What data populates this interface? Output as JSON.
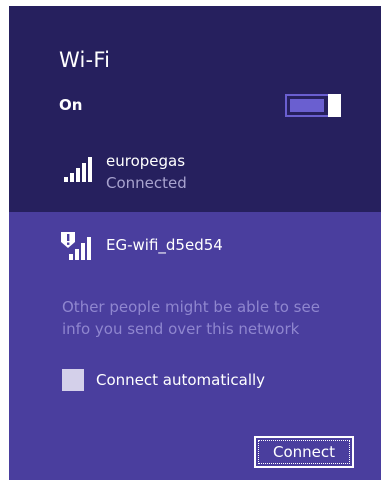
{
  "flyout": {
    "title": "Wi-Fi",
    "state_label": "On",
    "toggle_on": true
  },
  "networks": [
    {
      "name": "europegas",
      "status": "Connected",
      "icon": "wifi-signal-icon"
    }
  ],
  "selected_network": {
    "name": "EG-wifi_d5ed54",
    "icon": "wifi-unsecured-warning-icon",
    "warning": "Other people might be able to see info you send over this network",
    "auto_connect_label": "Connect automatically",
    "auto_connect_checked": false,
    "connect_label": "Connect"
  },
  "colors": {
    "panel_bg": "#26205e",
    "selected_bg": "#4a3e9e",
    "toggle_accent": "#6a5fd0",
    "muted_text": "#a8a3cf",
    "warning_text": "#8f86cf"
  }
}
